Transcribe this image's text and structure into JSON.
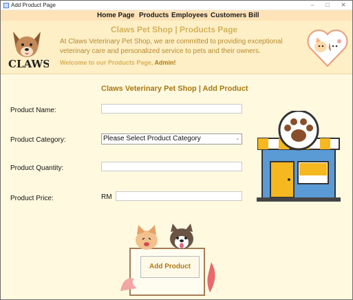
{
  "window": {
    "title": "Add Product Page"
  },
  "menu": {
    "items": [
      {
        "label": "Home Page"
      },
      {
        "label": "Products"
      },
      {
        "label": "Employees"
      },
      {
        "label": "Customers"
      },
      {
        "label": "Bill"
      }
    ]
  },
  "header": {
    "title": "Claws Pet Shop | Products Page",
    "description": "At Claws Veterinary Pet Shop, we are committed to providing exceptional veterinary care and personalized service to pets and their owners.",
    "welcome_prefix": "Welcome to our Products Page,",
    "welcome_user": "Admin!",
    "logo_text": "CLAWS"
  },
  "form": {
    "title": "Claws Veterinary Pet Shop | Add Product",
    "name_label": "Product Name:",
    "name_value": "",
    "category_label": "Product Category:",
    "category_selected": "Please Select Product Category",
    "quantity_label": "Product Quantity:",
    "quantity_value": "",
    "price_label": "Product Price:",
    "currency": "RM",
    "price_value": "",
    "submit_label": "Add Product"
  },
  "colors": {
    "background": "#fff9e0",
    "menubar": "#ffe3b8",
    "header": "#ffefc6",
    "accent": "#b07a10"
  }
}
